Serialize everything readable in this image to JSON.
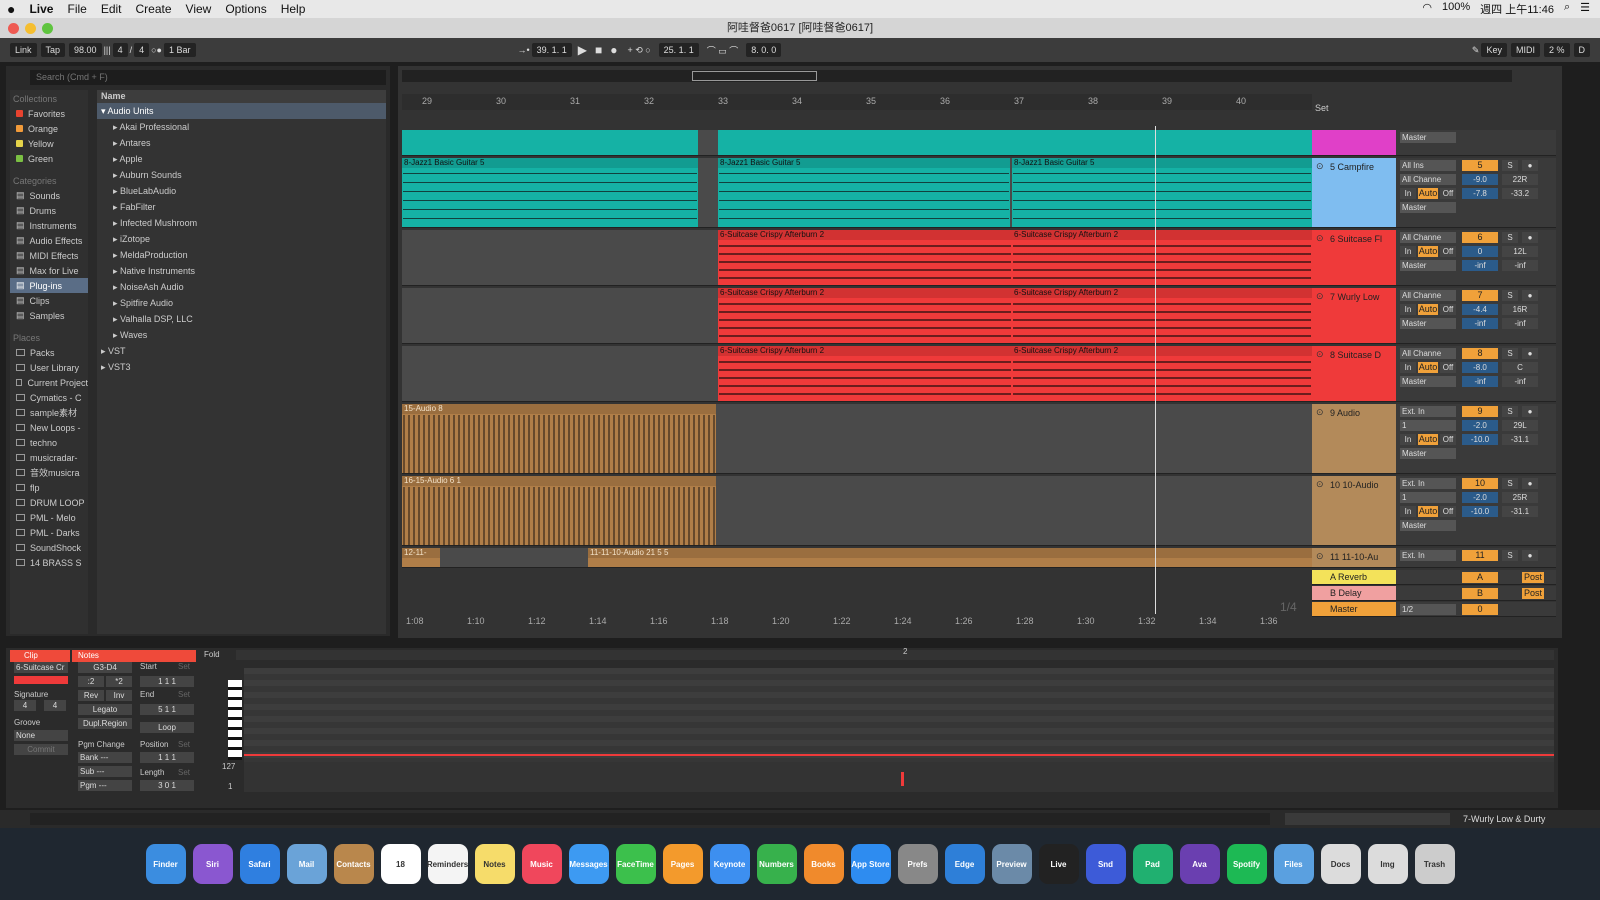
{
  "menubar": {
    "apple": "",
    "app": "Live",
    "items": [
      "File",
      "Edit",
      "Create",
      "View",
      "Options",
      "Help"
    ],
    "battery": "100%",
    "datetime": "週四 上午11:46"
  },
  "window": {
    "title": "阿哇督爸0617 [阿哇督爸0617]"
  },
  "transport": {
    "link": "Link",
    "tap": "Tap",
    "tempo": "98.00",
    "signature_num": "4",
    "signature_den": "4",
    "quantize": "1 Bar",
    "position": "39.  1.  1",
    "loop_start": "25.  1.  1",
    "loop_length": "8.  0.  0",
    "key": "Key",
    "midi": "MIDI",
    "cpu": "2 %",
    "d": "D"
  },
  "browser": {
    "search_placeholder": "Search (Cmd + F)",
    "collections_label": "Collections",
    "collections": [
      {
        "label": "Favorites",
        "color": "#e8432f"
      },
      {
        "label": "Orange",
        "color": "#f29b3a"
      },
      {
        "label": "Yellow",
        "color": "#e6d44a"
      },
      {
        "label": "Green",
        "color": "#7bc043"
      }
    ],
    "categories_label": "Categories",
    "categories": [
      "Sounds",
      "Drums",
      "Instruments",
      "Audio Effects",
      "MIDI Effects",
      "Max for Live",
      "Plug-ins",
      "Clips",
      "Samples"
    ],
    "places_label": "Places",
    "places": [
      "Packs",
      "User Library",
      "Current Project",
      "Cymatics - C",
      "sample素材",
      "New Loops -",
      "techno",
      "musicradar-",
      "音效musicra",
      "flp",
      "DRUM LOOP",
      "PML - Melo",
      "PML - Darks",
      "SoundShock",
      "14 BRASS S"
    ],
    "name_header": "Name",
    "folder": "Audio Units",
    "vendors": [
      "Akai Professional",
      "Antares",
      "Apple",
      "Auburn Sounds",
      "BlueLabAudio",
      "FabFilter",
      "Infected Mushroom",
      "iZotope",
      "MeldaProduction",
      "Native Instruments",
      "NoiseAsh Audio",
      "Spitfire Audio",
      "Valhalla DSP, LLC",
      "Waves"
    ],
    "other": [
      "VST",
      "VST3"
    ]
  },
  "ruler": {
    "bars": [
      "29",
      "30",
      "31",
      "32",
      "33",
      "34",
      "35",
      "36",
      "37",
      "38",
      "39",
      "40"
    ],
    "set": "Set"
  },
  "times": [
    "1:08",
    "1:10",
    "1:12",
    "1:14",
    "1:16",
    "1:18",
    "1:20",
    "1:22",
    "1:24",
    "1:26",
    "1:28",
    "1:30",
    "1:32",
    "1:34",
    "1:36"
  ],
  "zoom_label": "1/4",
  "tracks": [
    {
      "name": "",
      "clips": [],
      "color": "#e040c8",
      "output": "Master"
    },
    {
      "name": "5 Campfire",
      "input": "All Ins",
      "channel": "All Channe",
      "num": "5",
      "vol": "-9.0",
      "pan": "22R",
      "v2": "-7.8",
      "v3": "-33.2",
      "output": "Master",
      "color": "#7fbdf0",
      "clips": [
        "8-Jazz1 Basic Guitar 5",
        "8-Jazz1 Basic Guitar 5",
        "8-Jazz1 Basic Guitar 5"
      ]
    },
    {
      "name": "6 Suitcase Fl",
      "input": "All Channe",
      "num": "6",
      "vol": "0",
      "pan": "12L",
      "v2": "-inf",
      "v3": "-inf",
      "output": "Master",
      "color": "#ef3a3a",
      "clips": [
        "6-Suitcase Crispy Afterburn 2",
        "6-Suitcase Crispy Afterburn 2"
      ]
    },
    {
      "name": "7 Wurly Low",
      "input": "All Channe",
      "num": "7",
      "vol": "-4.4",
      "pan": "16R",
      "v2": "-inf",
      "v3": "-inf",
      "output": "Master",
      "color": "#ef3a3a",
      "clips": [
        "6-Suitcase Crispy Afterburn 2",
        "6-Suitcase Crispy Afterburn 2"
      ]
    },
    {
      "name": "8 Suitcase D",
      "input": "All Channe",
      "num": "8",
      "vol": "-8.0",
      "pan": "C",
      "v2": "-inf",
      "v3": "-inf",
      "output": "Master",
      "color": "#ef3a3a",
      "clips": [
        "6-Suitcase Crispy Afterburn 2",
        "6-Suitcase Crispy Afterburn 2"
      ]
    },
    {
      "name": "9 Audio",
      "input": "Ext. In",
      "channel": "1",
      "num": "9",
      "vol": "-2.0",
      "pan": "29L",
      "v2": "-10.0",
      "v3": "-31.1",
      "output": "Master",
      "color": "#b38a5a",
      "clips": [
        "15-Audio 8"
      ]
    },
    {
      "name": "10 10-Audio",
      "input": "Ext. In",
      "channel": "1",
      "num": "10",
      "vol": "-2.0",
      "pan": "25R",
      "v2": "-10.0",
      "v3": "-31.1",
      "output": "Master",
      "color": "#b38a5a",
      "clips": [
        "16-15-Audio 6 1"
      ]
    },
    {
      "name": "11 11-10-Au",
      "input": "Ext. In",
      "num": "11",
      "color": "#b38a5a",
      "clips": [
        "12-11-",
        "11-11-10-Audio 21 5 5"
      ]
    }
  ],
  "returns": [
    {
      "name": "A Reverb",
      "num": "A",
      "color": "#f3e25a",
      "post": "Post"
    },
    {
      "name": "B Delay",
      "num": "B",
      "color": "#f0a0a0",
      "post": "Post"
    },
    {
      "name": "Master",
      "num": "0",
      "color": "#f0a13a",
      "ratio": "1/2"
    }
  ],
  "common": {
    "in": "In",
    "auto": "Auto",
    "off": "Off",
    "s": "S"
  },
  "detail": {
    "clip_tab": "Clip",
    "notes_tab": "Notes",
    "clip_name": "6-Suitcase Cr",
    "signature_label": "Signature",
    "sig_num": "4",
    "sig_den": "4",
    "groove_label": "Groove",
    "groove": "None",
    "commit": "Commit",
    "range": "G3-D4",
    "half": ":2",
    "double": "*2",
    "rev": "Rev",
    "inv": "Inv",
    "legato": "Legato",
    "dupl": "Dupl.Region",
    "pgm_change": "Pgm Change",
    "bank": "Bank ---",
    "sub": "Sub ---",
    "pgm": "Pgm ---",
    "start_label": "Start",
    "end_label": "End",
    "loop": "Loop",
    "position_label": "Position",
    "length_label": "Length",
    "set": "Set",
    "start": [
      "1",
      "1",
      "1"
    ],
    "end": [
      "5",
      "1",
      "1"
    ],
    "position": [
      "1",
      "1",
      "1"
    ],
    "length": [
      "3",
      "0",
      "1"
    ],
    "fold": "Fold",
    "marker": "2",
    "vel_max": "127",
    "vel_min": "1"
  },
  "status": {
    "selected": "7-Wurly Low & Durty"
  },
  "dock": [
    "Finder",
    "Siri",
    "Safari",
    "Mail",
    "Contacts",
    "18",
    "Reminders",
    "Notes",
    "Music",
    "Messages",
    "FaceTime",
    "Pages",
    "Keynote",
    "Numbers",
    "Books",
    "App Store",
    "Prefs",
    "Edge",
    "Preview",
    "Live",
    "Snd",
    "Pad",
    "Ava",
    "Spotify",
    "Files",
    "Docs",
    "Img",
    "Trash"
  ]
}
